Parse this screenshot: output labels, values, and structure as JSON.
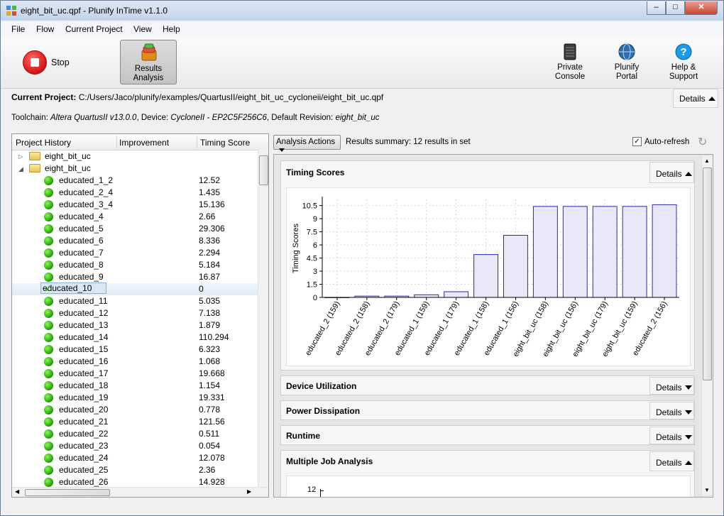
{
  "window": {
    "title": "eight_bit_uc.qpf - Plunify InTime v1.1.0",
    "min": "–",
    "max": "□",
    "close": "✕"
  },
  "menu": [
    "File",
    "Flow",
    "Current Project",
    "View",
    "Help"
  ],
  "toolbar": {
    "stop_label": "Stop",
    "results_line1": "Results",
    "results_line2": "Analysis",
    "private_line1": "Private",
    "private_line2": "Console",
    "portal_line1": "Plunify",
    "portal_line2": "Portal",
    "help_line1": "Help &",
    "help_line2": "Support"
  },
  "project": {
    "label": "Current Project:",
    "path": "C:/Users/Jaco/plunify/examples/QuartusII/eight_bit_uc_cycloneii/eight_bit_uc.qpf",
    "details_label": "Details"
  },
  "toolchain": {
    "label": "Toolchain:",
    "toolchain_value": "Altera QuartusII v13.0.0",
    "device_label": ", Device:",
    "device_value": "CycloneII - EP2C5F256C6",
    "revision_label": ", Default Revision:",
    "revision_value": "eight_bit_uc"
  },
  "history": {
    "headers": [
      "Project History",
      "Improvement",
      "Timing Score"
    ],
    "folders": [
      "eight_bit_uc",
      "eight_bit_uc"
    ],
    "rows": [
      {
        "name": "educated_1_2",
        "score": "12.52"
      },
      {
        "name": "educated_2_4",
        "score": "1.435"
      },
      {
        "name": "educated_3_4",
        "score": "15.136"
      },
      {
        "name": "educated_4",
        "score": "2.66"
      },
      {
        "name": "educated_5",
        "score": "29.306"
      },
      {
        "name": "educated_6",
        "score": "8.336"
      },
      {
        "name": "educated_7",
        "score": "2.294"
      },
      {
        "name": "educated_8",
        "score": "5.184"
      },
      {
        "name": "educated_9",
        "score": "16.87"
      },
      {
        "name": "educated_10",
        "score": "0"
      },
      {
        "name": "educated_11",
        "score": "5.035"
      },
      {
        "name": "educated_12",
        "score": "7.138"
      },
      {
        "name": "educated_13",
        "score": "1.879"
      },
      {
        "name": "educated_14",
        "score": "110.294"
      },
      {
        "name": "educated_15",
        "score": "6.323"
      },
      {
        "name": "educated_16",
        "score": "1.068"
      },
      {
        "name": "educated_17",
        "score": "19.668"
      },
      {
        "name": "educated_18",
        "score": "1.154"
      },
      {
        "name": "educated_19",
        "score": "19.331"
      },
      {
        "name": "educated_20",
        "score": "0.778"
      },
      {
        "name": "educated_21",
        "score": "121.56"
      },
      {
        "name": "educated_22",
        "score": "0.511"
      },
      {
        "name": "educated_23",
        "score": "0.054"
      },
      {
        "name": "educated_24",
        "score": "12.078"
      },
      {
        "name": "educated_25",
        "score": "2.36"
      },
      {
        "name": "educated_26",
        "score": "14.928"
      }
    ],
    "selected_index": 9
  },
  "results": {
    "actions_label": "Analysis Actions",
    "summary": "Results summary:  12 results in set",
    "autorefresh_label": "Auto-refresh",
    "details_label": "Details"
  },
  "sections": {
    "timing": "Timing Scores",
    "device": "Device Utilization",
    "power": "Power Dissipation",
    "runtime": "Runtime",
    "multi": "Multiple Job Analysis",
    "multi_tick": "12"
  },
  "chart_data": {
    "type": "bar",
    "title": "",
    "xlabel": "",
    "ylabel": "Timing Scores",
    "ylim": [
      0,
      11.2
    ],
    "yticks": [
      "0",
      "1.5",
      "3",
      "4.5",
      "6",
      "7.5",
      "9",
      "10.5"
    ],
    "categories": [
      "educated_2 (159)",
      "educated_2 (158)",
      "educated_2 (179)",
      "educated_1 (159)",
      "educated_1 (179)",
      "educated_1 (158)",
      "educated_1 (156)",
      "eight_bit_uc (158)",
      "eight_bit_uc (156)",
      "eight_bit_uc (179)",
      "eight_bit_uc (159)",
      "educated_2 (156)"
    ],
    "values": [
      0,
      0.15,
      0.15,
      0.3,
      0.65,
      4.9,
      7.1,
      10.4,
      10.4,
      10.4,
      10.4,
      10.6
    ],
    "colors": {
      "fill": "#e8e8f8",
      "stroke": "#2b2bb0"
    },
    "grid": true
  }
}
